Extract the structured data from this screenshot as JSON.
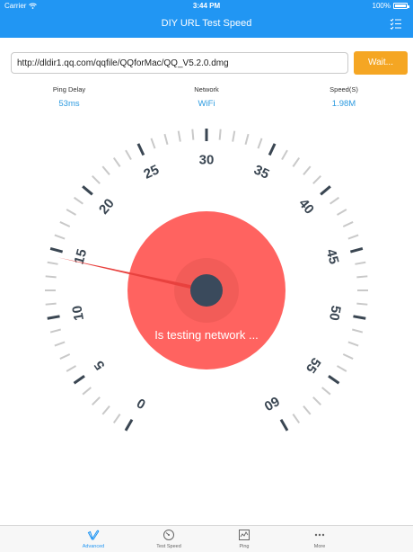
{
  "status": {
    "carrier": "Carrier",
    "time": "3:44 PM",
    "battery": "100%"
  },
  "nav": {
    "title": "DIY URL Test Speed"
  },
  "url": {
    "value": "http://dldir1.qq.com/qqfile/QQforMac/QQ_V5.2.0.dmg",
    "button": "Wait..."
  },
  "stats": [
    {
      "label": "Ping Delay",
      "value": "53ms"
    },
    {
      "label": "Network",
      "value": "WiFi"
    },
    {
      "label": "Speed(S)",
      "value": "1.98M"
    }
  ],
  "gauge": {
    "scale_labels": [
      "0",
      "5",
      "10",
      "15",
      "20",
      "25",
      "30",
      "35",
      "40",
      "45",
      "50",
      "55",
      "60"
    ],
    "scale_min": 0,
    "scale_max": 60,
    "needle_value": 14.5,
    "status_text": "Is testing network ..."
  },
  "tabs": [
    {
      "label": "Advanced",
      "icon": "vimeo-icon",
      "active": true
    },
    {
      "label": "Test Speed",
      "icon": "speedometer-icon",
      "active": false
    },
    {
      "label": "Ping",
      "icon": "ping-icon",
      "active": false
    },
    {
      "label": "More",
      "icon": "more-dots-icon",
      "active": false
    }
  ],
  "colors": {
    "accent": "#2196F3",
    "button": "#F5A623",
    "dial": "#FF6360",
    "hub": "#3A4A5C",
    "value_text": "#2d9be0"
  }
}
